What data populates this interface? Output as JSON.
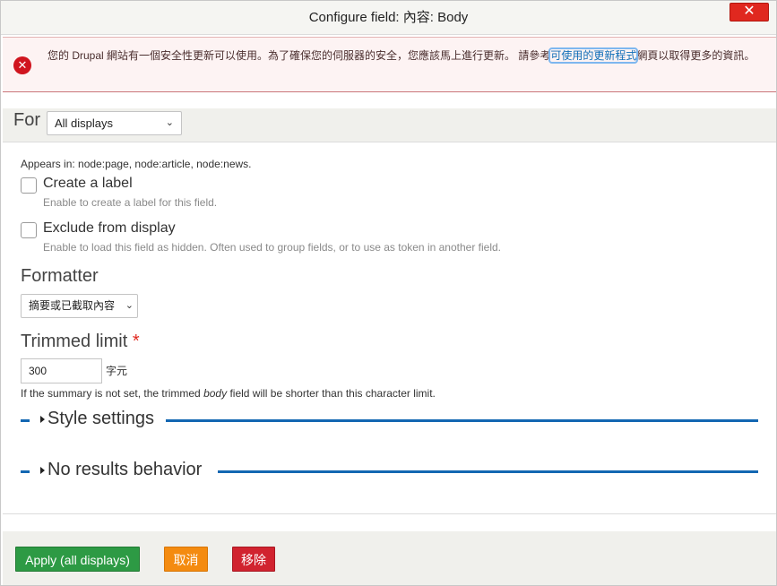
{
  "dialog": {
    "title": "Configure field: 內容: Body",
    "close_symbol": "✕"
  },
  "message": {
    "icon": "error-x-icon",
    "text_before": "您的 Drupal 網站有一個安全性更新可以使用。為了確保您的伺服器的安全，您應該馬上進行更新。 請參考",
    "link_text": "可使用的更新程式",
    "text_after": "網頁以取得更多的資訊。"
  },
  "display_select": {
    "label": "For",
    "value": "All displays"
  },
  "field": {
    "appears_in": "Appears in: node:page, node:article, node:news.",
    "create_label": {
      "label": "Create a label",
      "description": "Enable to create a label for this field.",
      "checked": false
    },
    "exclude_display": {
      "label": "Exclude from display",
      "description": "Enable to load this field as hidden. Often used to group fields, or to use as token in another field.",
      "checked": false
    },
    "formatter": {
      "heading": "Formatter",
      "value": "摘要或已截取內容"
    },
    "trimmed_limit": {
      "heading": "Trimmed limit",
      "required_mark": "*",
      "value": "300",
      "suffix": "字元",
      "desc_before": "If the summary is not set, the trimmed ",
      "desc_em": "body",
      "desc_after": " field will be shorter than this character limit."
    },
    "style_settings": "Style settings",
    "no_results": "No results behavior"
  },
  "buttons": {
    "apply": "Apply (all displays)",
    "cancel": "取消",
    "remove": "移除"
  },
  "colors": {
    "apply": "#2d9a44",
    "cancel": "#f48b10",
    "remove": "#d1232f",
    "accent_line": "#1367b2",
    "error": "#d0151f"
  }
}
